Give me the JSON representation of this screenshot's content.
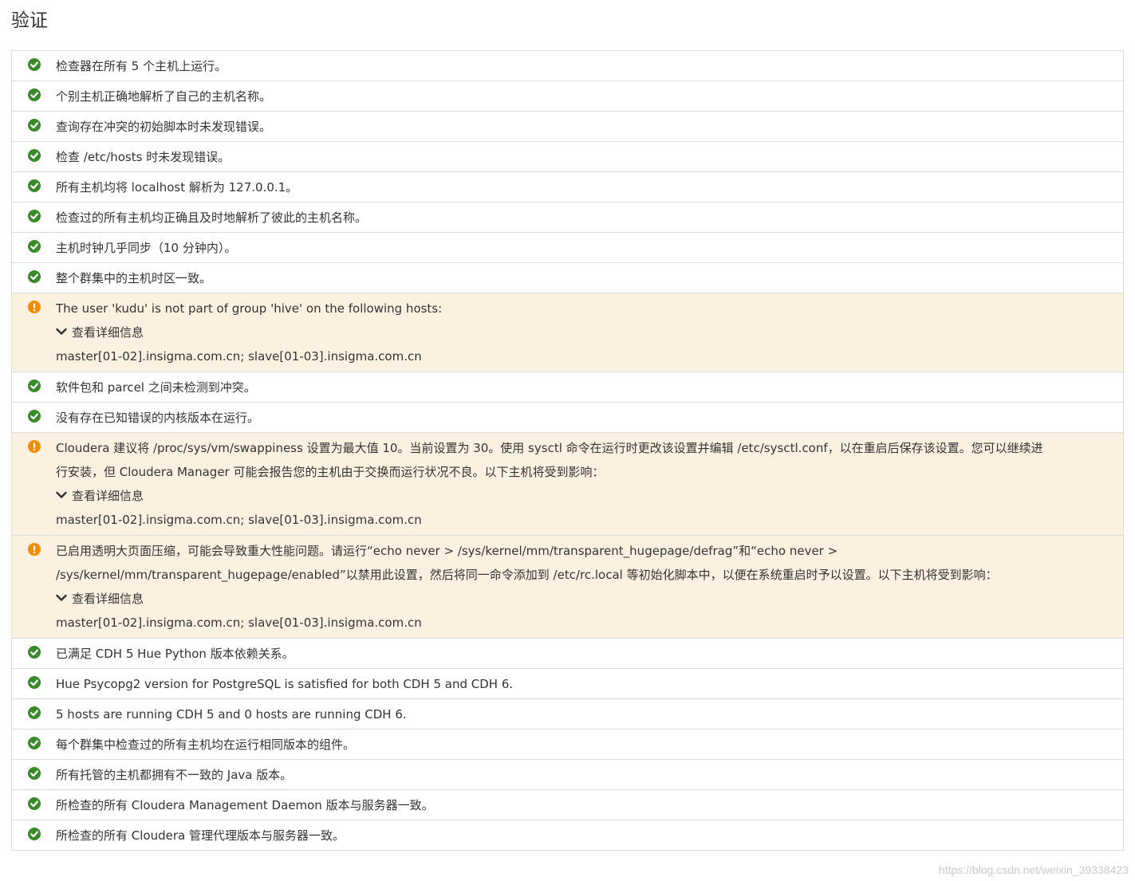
{
  "page_title": "验证",
  "colors": {
    "ok": "#3a8a2c",
    "warn": "#f08c00",
    "warn_bg": "#fcf1e0",
    "border": "#dddddd"
  },
  "icons": {
    "ok": "check-circle-icon",
    "warn": "exclamation-circle-icon",
    "toggle": "chevron-down-icon"
  },
  "checks": [
    {
      "status": "ok",
      "text": "检查器在所有 5 个主机上运行。"
    },
    {
      "status": "ok",
      "text": "个别主机正确地解析了自己的主机名称。"
    },
    {
      "status": "ok",
      "text": "查询存在冲突的初始脚本时未发现错误。"
    },
    {
      "status": "ok",
      "text": "检查 /etc/hosts 时未发现错误。"
    },
    {
      "status": "ok",
      "text": "所有主机均将 localhost 解析为 127.0.0.1。"
    },
    {
      "status": "ok",
      "text": "检查过的所有主机均正确且及时地解析了彼此的主机名称。"
    },
    {
      "status": "ok",
      "text": "主机时钟几乎同步（10 分钟内）。"
    },
    {
      "status": "ok",
      "text": "整个群集中的主机时区一致。"
    },
    {
      "status": "warn",
      "text_lines": [
        "The user 'kudu' is not part of group 'hive' on the following hosts:"
      ],
      "details_label": "查看详细信息",
      "hosts": "master[01-02].insigma.com.cn; slave[01-03].insigma.com.cn"
    },
    {
      "status": "ok",
      "text": "软件包和 parcel 之间未检测到冲突。"
    },
    {
      "status": "ok",
      "text": "没有存在已知错误的内核版本在运行。"
    },
    {
      "status": "warn",
      "text_lines": [
        "Cloudera 建议将 /proc/sys/vm/swappiness 设置为最大值 10。当前设置为 30。使用 sysctl 命令在运行时更改该设置并编辑 /etc/sysctl.conf，以在重启后保存该设置。您可以继续进",
        "行安装，但 Cloudera Manager 可能会报告您的主机由于交换而运行状况不良。以下主机将受到影响："
      ],
      "details_label": "查看详细信息",
      "hosts": "master[01-02].insigma.com.cn; slave[01-03].insigma.com.cn"
    },
    {
      "status": "warn",
      "text_lines": [
        "已启用透明大页面压缩，可能会导致重大性能问题。请运行“echo never > /sys/kernel/mm/transparent_hugepage/defrag”和“echo never >",
        "/sys/kernel/mm/transparent_hugepage/enabled”以禁用此设置，然后将同一命令添加到 /etc/rc.local 等初始化脚本中，以便在系统重启时予以设置。以下主机将受到影响："
      ],
      "details_label": "查看详细信息",
      "hosts": "master[01-02].insigma.com.cn; slave[01-03].insigma.com.cn"
    },
    {
      "status": "ok",
      "text": "已满足 CDH 5 Hue Python 版本依赖关系。"
    },
    {
      "status": "ok",
      "text": "Hue Psycopg2 version for PostgreSQL is satisfied for both CDH 5 and CDH 6."
    },
    {
      "status": "ok",
      "text": "5 hosts are running CDH 5 and 0 hosts are running CDH 6."
    },
    {
      "status": "ok",
      "text": "每个群集中检查过的所有主机均在运行相同版本的组件。"
    },
    {
      "status": "ok",
      "text": "所有托管的主机都拥有不一致的 Java 版本。"
    },
    {
      "status": "ok",
      "text": "所检查的所有 Cloudera Management Daemon 版本与服务器一致。"
    },
    {
      "status": "ok",
      "text": "所检查的所有 Cloudera 管理代理版本与服务器一致。"
    }
  ],
  "watermark": "https://blog.csdn.net/weixin_39338423"
}
